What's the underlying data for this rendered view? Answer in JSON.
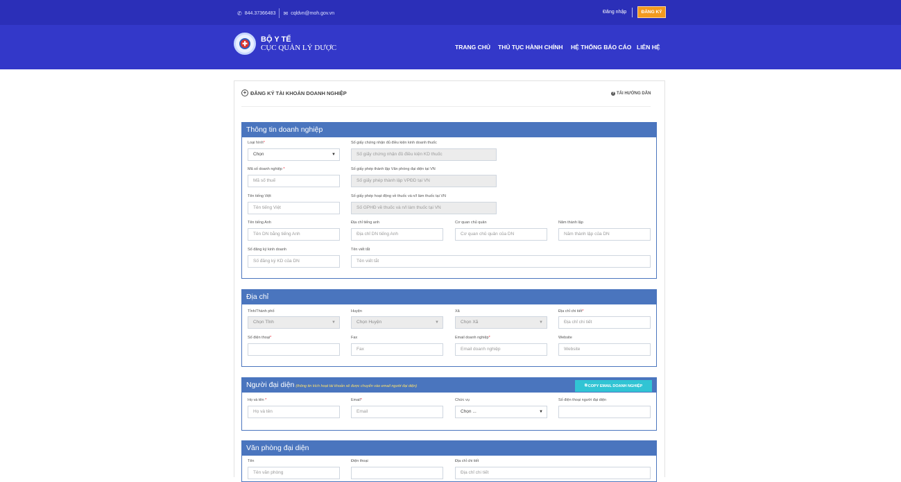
{
  "topbar": {
    "phone": "844.37366483",
    "email": "cqldvn@moh.gov.vn",
    "login": "Đăng nhập",
    "register": "ĐĂNG KÝ"
  },
  "brand": {
    "line1": "BỘ Y TẾ",
    "line2": "CỤC QUẢN LÝ DƯỢC"
  },
  "nav": [
    "TRANG CHỦ",
    "THỦ TỤC HÀNH CHÍNH",
    "HỆ THỐNG BÁO CÁO",
    "LIÊN HỆ"
  ],
  "page": {
    "title": "ĐĂNG KÝ TÀI KHOẢN DOANH NGHIỆP",
    "guide": "TẢI HƯỚNG DẪN"
  },
  "sections": {
    "company": "Thông tin doanh nghiệp",
    "address": "Địa chỉ",
    "rep": "Người đại diện",
    "rep_note": "(thông tin kích hoạt tài khoản sẽ được chuyển vào email người đại diện)",
    "copy_email": "COPY EMAIL DOANH NGHIỆP",
    "office": "Văn phòng đại diện"
  },
  "company": {
    "type_label": "Loại hình",
    "type_value": "Chọn",
    "cert_label": "Số giấy chứng nhận đủ điều kiện kinh doanh thuốc",
    "cert_ph": "Số giấy chứng nhận đủ điều kiện KD thuốc",
    "tax_label": "Mã số doanh nghiệp",
    "tax_ph": "Mã số thuế",
    "office_permit_label": "Số giấy phép thành lập Văn phòng đại diện tại VN",
    "office_permit_ph": "Số giấy phép thành lập VPĐD tại VN",
    "name_vn_label": "Tên tiếng Việt",
    "name_vn_ph": "Tên tiếng Việt",
    "drug_permit_label": "Số giấy phép hoạt động về thuốc và n/l làm thuốc tại VN",
    "drug_permit_ph": "Số GPHĐ về thuốc và n/l làm thuốc tại VN",
    "name_en_label": "Tên tiếng Anh",
    "name_en_ph": "Tên DN bằng tiếng Anh",
    "addr_en_label": "Địa chỉ tiếng anh",
    "addr_en_ph": "Địa chỉ DN tiếng Anh",
    "agency_label": "Cơ quan chủ quản",
    "agency_ph": "Cơ quan chủ quản của DN",
    "year_label": "Năm thành lập",
    "year_ph": "Năm thành lập của DN",
    "biz_label": "Số đăng ký kinh doanh",
    "biz_ph": "Số đăng ký KD của DN",
    "abbr_label": "Tên viết tắt",
    "abbr_ph": "Tên viết tắt"
  },
  "address": {
    "province_label": "Tỉnh/Thành phố",
    "province_value": "Chọn Tỉnh",
    "district_label": "Huyện",
    "district_value": "Chọn Huyện",
    "ward_label": "Xã",
    "ward_value": "Chọn Xã",
    "detail_label": "Địa chỉ chi tiết",
    "detail_ph": "Địa chỉ chi tiết",
    "phone_label": "Số điện thoại",
    "phone_ph": "",
    "fax_label": "Fax",
    "fax_ph": "Fax",
    "email_label": "Email doanh nghiệp",
    "email_ph": "Email doanh nghiệp",
    "web_label": "Website",
    "web_ph": "Website"
  },
  "rep": {
    "name_label": "Họ và tên",
    "name_ph": "Họ và tên",
    "email_label": "Email",
    "email_ph": "Email",
    "position_label": "Chức vụ",
    "position_value": "Chọn ...",
    "phone_label": "Số điện thoại người đại diện",
    "phone_ph": ""
  },
  "office": {
    "name_label": "Tên",
    "name_ph": "Tên văn phòng",
    "phone_label": "Điện thoại",
    "phone_ph": "",
    "addr_label": "Địa chỉ chi tiết",
    "addr_ph": "Địa chỉ chi tiết"
  },
  "required_mark": "*",
  "colors": {
    "topbar": "#2b2fb8",
    "header": "#3338c9",
    "section_head": "#4a75be",
    "register_btn": "#f39a1f",
    "copy_btn": "#31c4d4"
  }
}
